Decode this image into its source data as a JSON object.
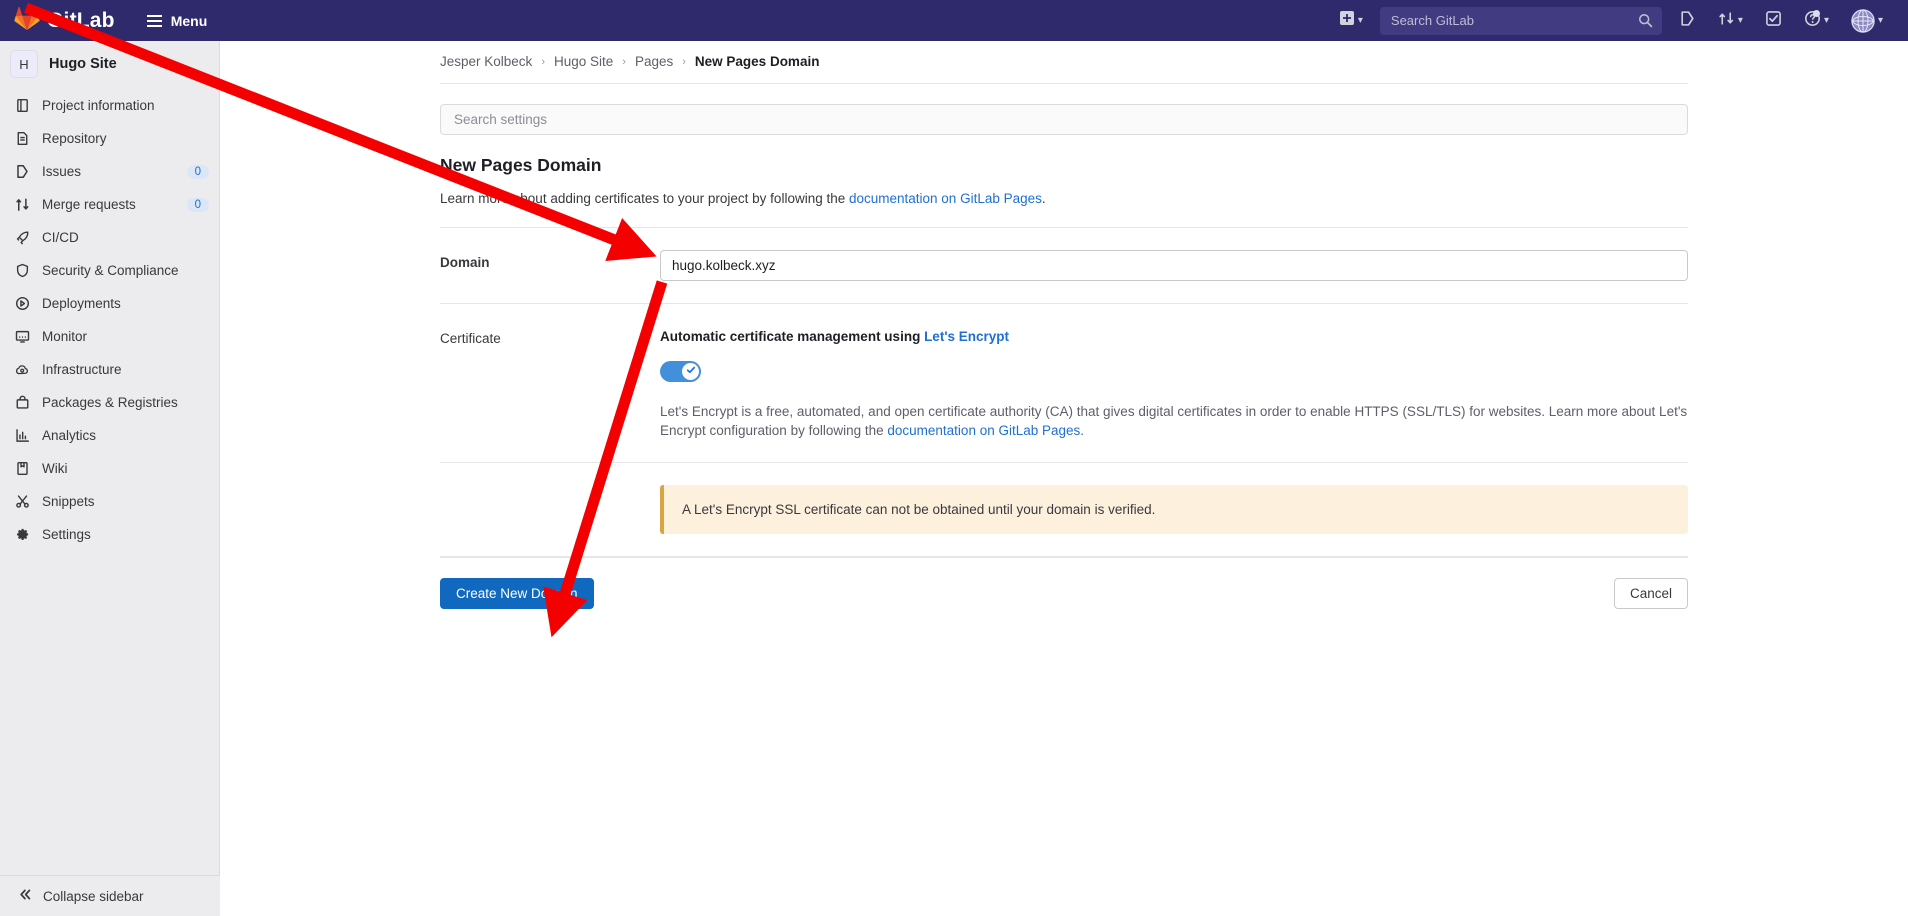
{
  "navbar": {
    "brand": "GitLab",
    "menu_label": "Menu",
    "logo_icon": "gitlab-tanuki-logo",
    "hamburger_icon": "hamburger-menu-icon",
    "create_new_icon": "plus-square-icon",
    "create_new_chevron_icon": "chevron-down-icon",
    "search": {
      "placeholder": "Search GitLab",
      "value": "",
      "icon": "search-icon"
    },
    "issues_icon": "issues-icon",
    "merge_requests_icon": "merge-request-icon",
    "merge_requests_chevron_icon": "chevron-down-icon",
    "todos_icon": "todo-checkbox-icon",
    "help_icon": "question-circle-icon",
    "help_chevron_icon": "chevron-down-icon",
    "avatar_icon": "user-avatar",
    "avatar_chevron_icon": "chevron-down-icon"
  },
  "sidebar": {
    "project": {
      "initial": "H",
      "name": "Hugo Site"
    },
    "items": [
      {
        "label": "Project information",
        "icon": "project-information-icon",
        "badge": ""
      },
      {
        "label": "Repository",
        "icon": "repository-icon",
        "badge": ""
      },
      {
        "label": "Issues",
        "icon": "issues-icon",
        "badge": "0"
      },
      {
        "label": "Merge requests",
        "icon": "merge-request-icon",
        "badge": "0"
      },
      {
        "label": "CI/CD",
        "icon": "rocket-icon",
        "badge": ""
      },
      {
        "label": "Security & Compliance",
        "icon": "shield-icon",
        "badge": ""
      },
      {
        "label": "Deployments",
        "icon": "deployments-icon",
        "badge": ""
      },
      {
        "label": "Monitor",
        "icon": "monitor-icon",
        "badge": ""
      },
      {
        "label": "Infrastructure",
        "icon": "cloud-gear-icon",
        "badge": ""
      },
      {
        "label": "Packages & Registries",
        "icon": "package-icon",
        "badge": ""
      },
      {
        "label": "Analytics",
        "icon": "chart-bar-icon",
        "badge": ""
      },
      {
        "label": "Wiki",
        "icon": "book-icon",
        "badge": ""
      },
      {
        "label": "Snippets",
        "icon": "scissors-icon",
        "badge": ""
      },
      {
        "label": "Settings",
        "icon": "gear-icon",
        "badge": ""
      }
    ],
    "collapse_label": "Collapse sidebar",
    "collapse_icon": "double-chevron-left-icon"
  },
  "breadcrumb": {
    "items": [
      {
        "label": "Jesper Kolbeck",
        "current": false
      },
      {
        "label": "Hugo Site",
        "current": false
      },
      {
        "label": "Pages",
        "current": false
      },
      {
        "label": "New Pages Domain",
        "current": true
      }
    ],
    "separator": "›"
  },
  "settings_search": {
    "placeholder": "Search settings",
    "value": ""
  },
  "main": {
    "title": "New Pages Domain",
    "intro_prefix": "Learn more about adding certificates to your project by following the ",
    "intro_link": "documentation on GitLab Pages",
    "intro_suffix": ".",
    "domain": {
      "label": "Domain",
      "value": "hugo.kolbeck.xyz",
      "placeholder": ""
    },
    "certificate": {
      "label": "Certificate",
      "heading_prefix": "Automatic certificate management using ",
      "heading_link": "Let's Encrypt",
      "toggle_state": "on",
      "toggle_check_icon": "check-icon",
      "description_prefix": "Let's Encrypt is a free, automated, and open certificate authority (CA) that gives digital certificates in order to enable HTTPS (SSL/TLS) for websites. Learn more about Let's Encrypt configuration by following the ",
      "description_link": "documentation on GitLab Pages",
      "description_suffix": "."
    },
    "alert": {
      "message": "A Let's Encrypt SSL certificate can not be obtained until your domain is verified."
    },
    "submit_label": "Create New Domain",
    "cancel_label": "Cancel"
  },
  "annotations": {
    "arrow_color": "#f50000",
    "arrow_1": "points-to-domain-input",
    "arrow_2": "points-to-create-new-domain-button"
  },
  "colors": {
    "navbar_bg": "#2f2a6b",
    "sidebar_bg": "#ececef",
    "primary_button": "#1068bf",
    "link": "#1f6fd4",
    "toggle_on": "#428fdc",
    "alert_bg": "#fdf1dd",
    "alert_border": "#d9a441"
  }
}
